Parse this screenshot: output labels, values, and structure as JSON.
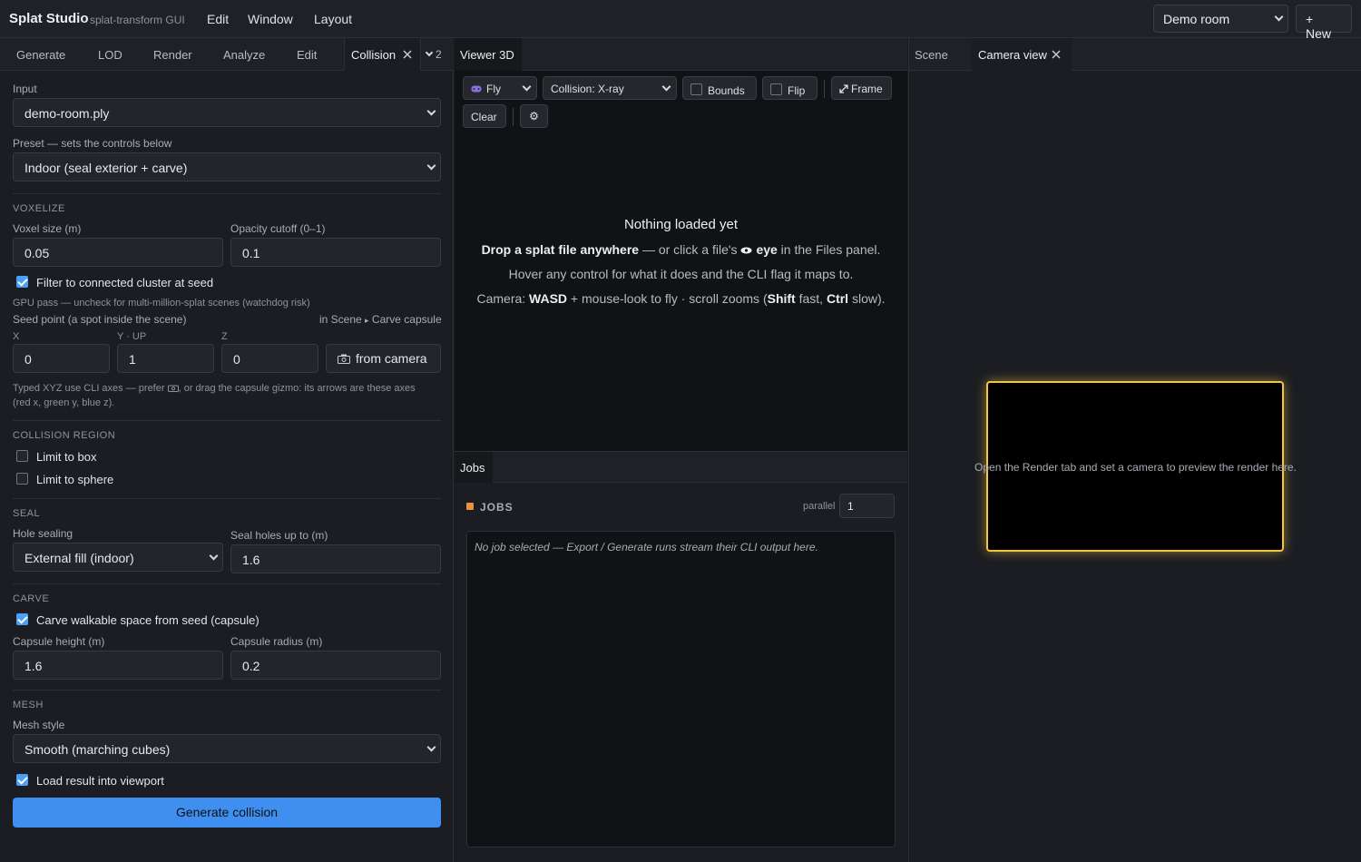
{
  "app": {
    "title": "Splat Studio",
    "subtitle": "splat-transform GUI"
  },
  "menu": [
    "Edit",
    "Window",
    "Layout"
  ],
  "project": {
    "selected": "Demo room",
    "new_label": "+ New"
  },
  "left": {
    "tabs": [
      "Generate",
      "LOD",
      "Render",
      "Analyze",
      "Edit"
    ],
    "active_tab": "Collision",
    "overflow": "2",
    "input_label": "Input",
    "input_value": "demo-room.ply",
    "preset_label": "Preset — sets the controls below",
    "preset_value": "Indoor (seal exterior + carve)",
    "voxelize": {
      "heading": "VOXELIZE",
      "voxel_label": "Voxel size (m)",
      "voxel_value": "0.05",
      "opacity_label": "Opacity cutoff (0–1)",
      "opacity_value": "0.1",
      "filter_label": "Filter to connected cluster at seed",
      "filter_checked": true,
      "gpu_hint": "GPU pass — uncheck for multi-million-splat scenes (watchdog risk)",
      "seed_label": "Seed point (a spot inside the scene)",
      "seed_link_a": "in Scene",
      "seed_link_sep": "▸",
      "seed_link_b": "Carve capsule",
      "x_label": "X",
      "x_value": "0",
      "y_label": "Y · UP",
      "y_value": "1",
      "z_label": "Z",
      "z_value": "0",
      "from_camera": "from camera",
      "axes_hint_a": "Typed XYZ use CLI axes — prefer",
      "axes_hint_b": ", or drag the capsule gizmo: its arrows are these axes",
      "axes_hint_c": "(red x, green y, blue z)."
    },
    "region": {
      "heading": "COLLISION REGION",
      "box_label": "Limit to box",
      "sphere_label": "Limit to sphere"
    },
    "seal": {
      "heading": "SEAL",
      "hole_label": "Hole sealing",
      "hole_value": "External fill (indoor)",
      "upto_label": "Seal holes up to (m)",
      "upto_value": "1.6"
    },
    "carve": {
      "heading": "CARVE",
      "carve_label": "Carve walkable space from seed (capsule)",
      "height_label": "Capsule height (m)",
      "height_value": "1.6",
      "radius_label": "Capsule radius (m)",
      "radius_value": "0.2"
    },
    "mesh": {
      "heading": "MESH",
      "style_label": "Mesh style",
      "style_value": "Smooth (marching cubes)",
      "load_label": "Load result into viewport"
    },
    "generate_label": "Generate collision"
  },
  "viewer": {
    "tab": "Viewer 3D",
    "fly": "Fly",
    "mode": "Collision: X-ray",
    "bounds": "Bounds",
    "flip": "Flip",
    "frame": "Frame",
    "clear": "Clear",
    "settings_glyph": "⚙",
    "empty_title": "Nothing loaded yet",
    "line1_bold": "Drop a splat file anywhere",
    "line1_mid": " — or click a file's ",
    "line1_eye": "eye",
    "line1_end": " in the Files panel.",
    "line2": "Hover any control for what it does and the CLI flag it maps to.",
    "line3_a": "Camera: ",
    "line3_wasd": "WASD",
    "line3_b": " + mouse-look to fly · scroll zooms (",
    "line3_shift": "Shift",
    "line3_c": " fast, ",
    "line3_ctrl": "Ctrl",
    "line3_d": " slow)."
  },
  "jobs": {
    "tab": "Jobs",
    "heading": "JOBS",
    "parallel_label": "parallel",
    "parallel_value": "1",
    "empty": "No job selected — Export / Generate runs stream their CLI output here."
  },
  "right": {
    "tab_scene": "Scene",
    "tab_camera": "Camera view",
    "preview_text": "Open the Render tab and set a camera to preview the render here."
  },
  "colors": {
    "accent": "#3e8ff0",
    "highlight": "#f5c542",
    "jobs_dot": "#e8943a"
  }
}
